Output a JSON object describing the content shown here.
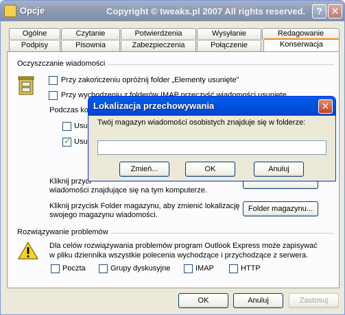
{
  "window": {
    "title": "Opcje",
    "copyright": "Copyright © tweaks.pl 2007 All rights reserved.",
    "help_glyph": "?",
    "close_glyph": "✕"
  },
  "tabs_back": [
    "Ogólne",
    "Czytanie",
    "Potwierdzenia",
    "Wysyłanie",
    "Redagowanie"
  ],
  "tabs_front": [
    "Podpisy",
    "Pisownia",
    "Zabezpieczenia",
    "Połączenie",
    "Konserwacja"
  ],
  "active_tab": "Konserwacja",
  "cleanup": {
    "header": "Oczyszczanie wiadomości",
    "empty_deleted": "Przy zakończeniu opróżnij folder „Elementy usunięte”",
    "imap_purge": "Przy wychodzeniu z folderów IMAP przeczyść wiadomości usunięte",
    "during_prefix": "Podczas ko",
    "usun1": "Usu",
    "usun2": "Usu",
    "click_text1": "Kliknij przyci",
    "click_text2": "wiadomości znajdujące się na tym komputerze.",
    "store_text1": "Kliknij przycisk Folder magazynu, aby zmienić lokalizację",
    "store_text2": "swojego magazynu wiadomości.",
    "store_button": "Folder magazynu..."
  },
  "troubleshoot": {
    "header": "Rozwiązywanie problemów",
    "text1": "Dla celów rozwiązywania problemów program Outlook Express może zapisywać",
    "text2": "w pliku dziennika wszystkie polecenia wychodzące i przychodzące z serwera.",
    "options": [
      "Poczta",
      "Grupy dyskusyjne",
      "IMAP",
      "HTTP"
    ]
  },
  "footer": {
    "ok": "OK",
    "cancel": "Anuluj",
    "apply": "Zastosuj"
  },
  "dialog": {
    "title": "Lokalizacja przechowywania",
    "message": "Twój magazyn wiadomości osobistych znajduje się w folderze:",
    "path_value": "",
    "change": "Zmień...",
    "ok": "OK",
    "cancel": "Anuluj",
    "close_glyph": "✕"
  }
}
